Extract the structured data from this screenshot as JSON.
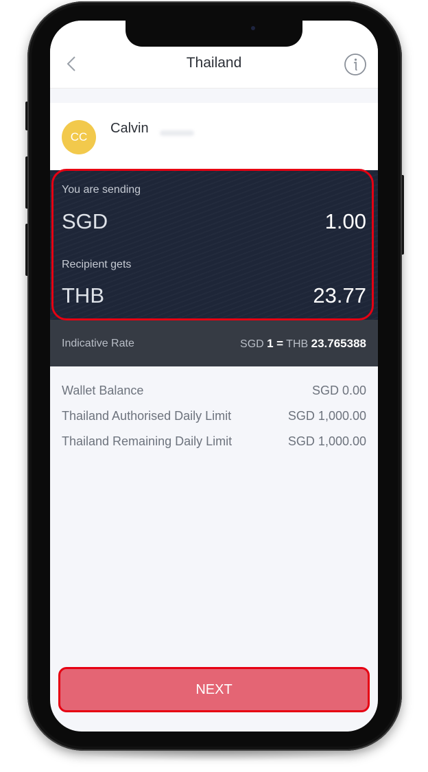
{
  "header": {
    "title": "Thailand"
  },
  "recipient": {
    "initials": "CC",
    "name": "Calvin"
  },
  "sending": {
    "label": "You are sending",
    "currency": "SGD",
    "amount": "1.00"
  },
  "receiving": {
    "label": "Recipient gets",
    "currency": "THB",
    "amount": "23.77"
  },
  "rate": {
    "label": "Indicative Rate",
    "from_currency": "SGD",
    "from_amount": "1",
    "equals": "=",
    "to_currency": "THB",
    "to_amount": "23.765388"
  },
  "details": [
    {
      "label": "Wallet Balance",
      "value": "SGD 0.00"
    },
    {
      "label": "Thailand Authorised Daily Limit",
      "value": "SGD 1,000.00"
    },
    {
      "label": "Thailand Remaining Daily Limit",
      "value": "SGD 1,000.00"
    }
  ],
  "next_button": {
    "label": "NEXT"
  },
  "colors": {
    "avatar": "#f2c94c",
    "dark_panel": "#1e2638",
    "rate_bar": "#363b44",
    "next_button": "#e46574",
    "highlight": "#e60012",
    "background": "#f5f6fa"
  }
}
